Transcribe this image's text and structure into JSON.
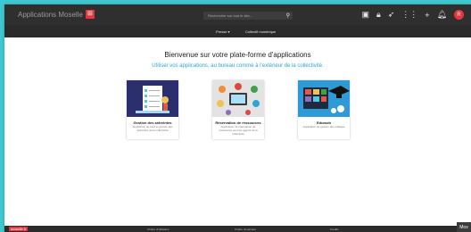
{
  "header": {
    "app_title": "Applications Moselle",
    "search_placeholder": "Rechercher sur tout le site...",
    "icons": [
      "square-icon",
      "lock-icon",
      "send-icon",
      "apps-grid-icon",
      "plus-icon",
      "bell-icon",
      "avatar"
    ],
    "avatar_initial": "R"
  },
  "nav": {
    "items": [
      "Presse ▾",
      "Collectif numérique"
    ]
  },
  "main": {
    "welcome": "Bienvenue sur votre plate-forme d'applications",
    "subtitle": "Utiliser vos applications, au bureau comme à l'extérieur de la collectivité."
  },
  "cards": [
    {
      "title": "Gestion des astreintes",
      "desc": "Application de suivi et gestion des astreintes de la collectivité"
    },
    {
      "title": "Réservation de ressources",
      "desc": "Application de réservation de ressources pour les agents de la collectivité"
    },
    {
      "title": "Edumob",
      "desc": "Application de gestion des collèges"
    }
  ],
  "footer": {
    "logo": "moselle.fr",
    "links": [
      "Charte d'utilisation",
      "Charte numérique",
      "Crédits"
    ]
  },
  "mos_badge": "Mos"
}
